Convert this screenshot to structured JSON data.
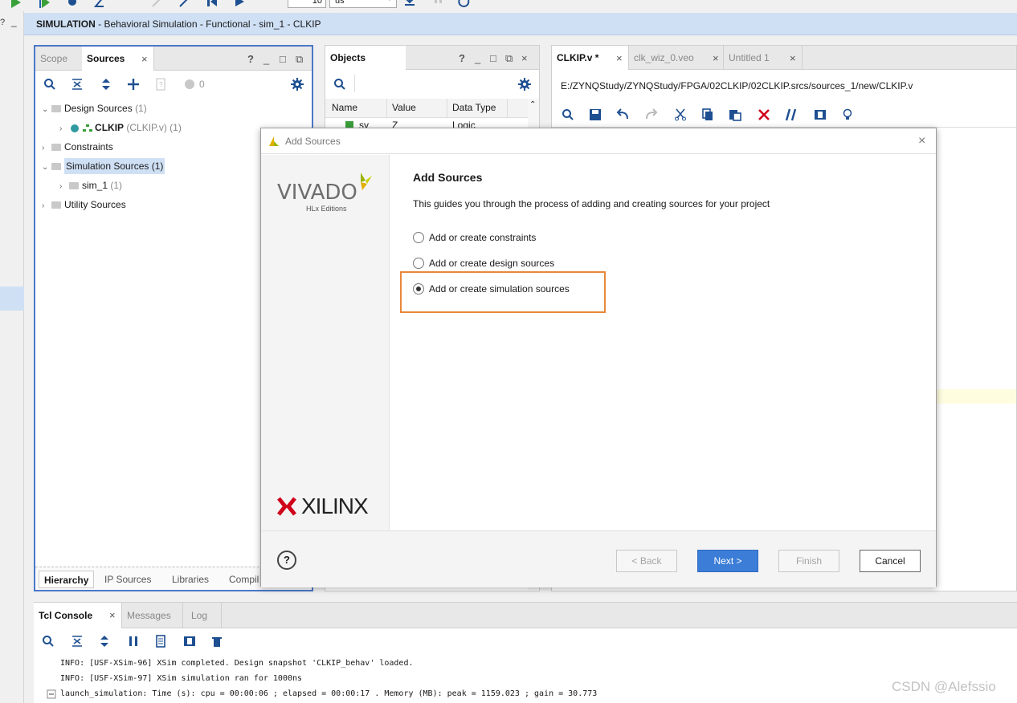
{
  "toolbar": {
    "time_value": "10",
    "time_unit": "us"
  },
  "sim_header": {
    "mode": "SIMULATION",
    "detail": " - Behavioral Simulation - Functional - sim_1 - CLKIP"
  },
  "sources_panel": {
    "tabs": [
      "Scope",
      "Sources"
    ],
    "help": "?",
    "count": "0",
    "tree": {
      "design_sources": {
        "label": "Design Sources",
        "count": "(1)"
      },
      "clkip": {
        "label": "CLKIP",
        "detail": "(CLKIP.v) (1)"
      },
      "constraints": {
        "label": "Constraints"
      },
      "simulation_sources": {
        "label": "Simulation Sources (1)"
      },
      "sim_1": {
        "label": "sim_1",
        "count": "(1)"
      },
      "utility_sources": {
        "label": "Utility Sources"
      }
    },
    "bottom_tabs": [
      "Hierarchy",
      "IP Sources",
      "Libraries",
      "Compil"
    ]
  },
  "objects_panel": {
    "title": "Objects",
    "help": "?",
    "columns": [
      "Name",
      "Value",
      "Data Type"
    ],
    "rows": [
      {
        "name": "sy",
        "value": "Z",
        "type": "Logic"
      }
    ]
  },
  "editor": {
    "tabs": [
      "CLKIP.v *",
      "clk_wiz_0.veo",
      "Untitled 1"
    ],
    "path": "E:/ZYNQStudy/ZYNQStudy/FPGA/02CLKIP/02CLKIP.srcs/sources_1/new/CLKIP.v"
  },
  "dialog": {
    "title": "Add Sources",
    "heading": "Add Sources",
    "description": "This guides you through the process of adding and creating sources for your project",
    "options": [
      {
        "label": "Add or create constraints",
        "selected": false
      },
      {
        "label": "Add or create design sources",
        "selected": false
      },
      {
        "label": "Add or create simulation sources",
        "selected": true
      }
    ],
    "vivado_logo": "VIVADO",
    "vivado_sub": "HLx Editions",
    "xilinx_logo": "XILINX",
    "help": "?",
    "buttons": {
      "back": "< Back",
      "next": "Next >",
      "finish": "Finish",
      "cancel": "Cancel"
    },
    "highlight_color": "#e8883a"
  },
  "console": {
    "tabs": [
      "Tcl Console",
      "Messages",
      "Log"
    ],
    "lines": [
      "INFO: [USF-XSim-96] XSim completed. Design snapshot 'CLKIP_behav' loaded.",
      "INFO: [USF-XSim-97] XSim simulation ran for 1000ns",
      "launch_simulation: Time (s): cpu = 00:00:06 ; elapsed = 00:00:17 . Memory (MB): peak = 1159.023 ; gain = 30.773"
    ]
  },
  "watermark": "CSDN @Alefssio",
  "colors": {
    "accent_blue": "#3c7dd8",
    "header_blue": "#cfe0f5",
    "panel_border": "#4a78c8",
    "delete_red": "#d0021b"
  }
}
